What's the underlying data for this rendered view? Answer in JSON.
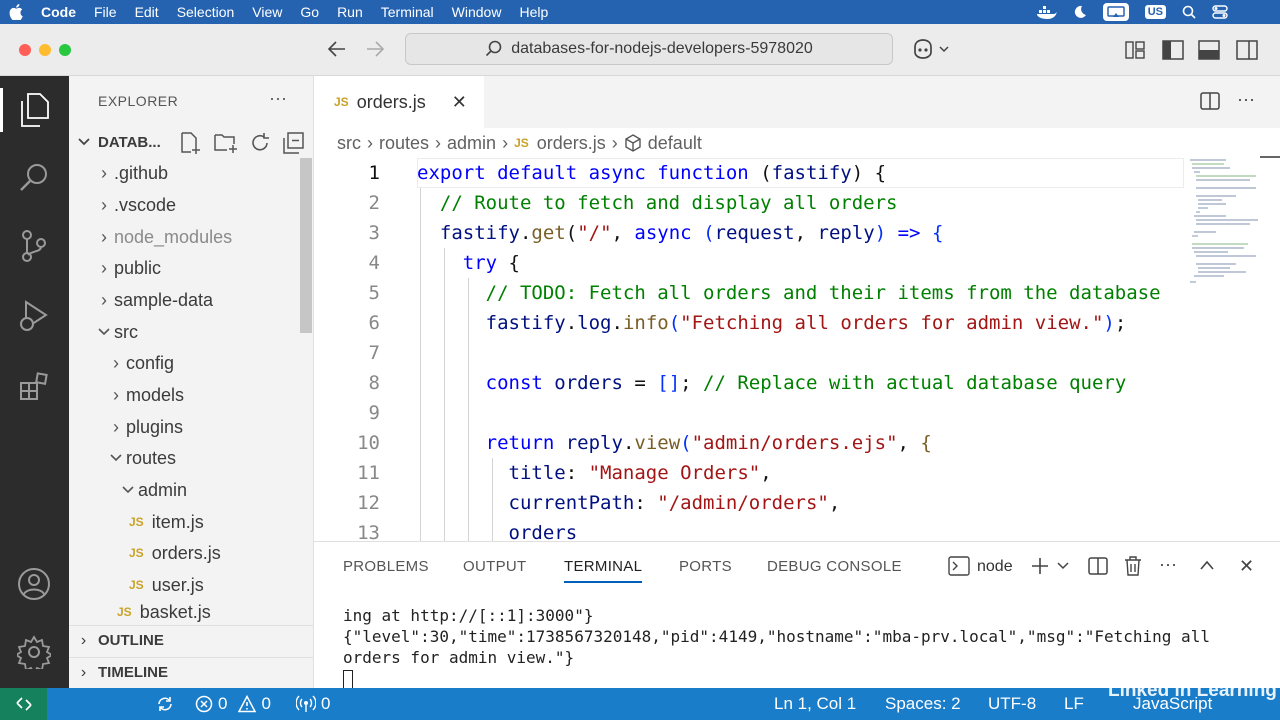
{
  "menubar": {
    "app": "Code",
    "items": [
      "File",
      "Edit",
      "Selection",
      "View",
      "Go",
      "Run",
      "Terminal",
      "Window",
      "Help"
    ],
    "input_badge": "US"
  },
  "titlebar": {
    "search_text": "databases-for-nodejs-developers-5978020"
  },
  "explorer": {
    "title": "EXPLORER",
    "root": "DATAB...",
    "tree": [
      {
        "label": ".github",
        "type": "folder",
        "state": "collapsed"
      },
      {
        "label": ".vscode",
        "type": "folder",
        "state": "collapsed"
      },
      {
        "label": "node_modules",
        "type": "folder",
        "state": "collapsed"
      },
      {
        "label": "public",
        "type": "folder",
        "state": "collapsed"
      },
      {
        "label": "sample-data",
        "type": "folder",
        "state": "collapsed"
      },
      {
        "label": "src",
        "type": "folder",
        "state": "expanded"
      },
      {
        "label": "config",
        "type": "folder",
        "state": "collapsed"
      },
      {
        "label": "models",
        "type": "folder",
        "state": "collapsed"
      },
      {
        "label": "plugins",
        "type": "folder",
        "state": "collapsed"
      },
      {
        "label": "routes",
        "type": "folder",
        "state": "expanded"
      },
      {
        "label": "admin",
        "type": "folder",
        "state": "expanded"
      },
      {
        "label": "item.js",
        "type": "file"
      },
      {
        "label": "orders.js",
        "type": "file"
      },
      {
        "label": "user.js",
        "type": "file"
      },
      {
        "label": "basket.js",
        "type": "file"
      }
    ],
    "outline": "OUTLINE",
    "timeline": "TIMELINE",
    "js_badge": "JS"
  },
  "editor": {
    "tab": "orders.js",
    "breadcrumb": [
      "src",
      "routes",
      "admin",
      "orders.js",
      "default"
    ],
    "line_numbers": [
      "1",
      "2",
      "3",
      "4",
      "5",
      "6",
      "7",
      "8",
      "9",
      "10",
      "11",
      "12",
      "13"
    ]
  },
  "panel": {
    "tabs": [
      "PROBLEMS",
      "OUTPUT",
      "TERMINAL",
      "PORTS",
      "DEBUG CONSOLE"
    ],
    "active_tab": "TERMINAL",
    "terminal_name": "node",
    "terminal_lines": [
      "ing at http://[::1]:3000\"}",
      "{\"level\":30,\"time\":1738567320148,\"pid\":4149,\"hostname\":\"mba-prv.local\",\"msg\":\"Fetching all",
      "orders for admin view.\"}"
    ]
  },
  "statusbar": {
    "errors": "0",
    "warnings": "0",
    "ports": "0",
    "position": "Ln 1, Col 1",
    "spaces": "Spaces: 2",
    "encoding": "UTF-8",
    "eol": "LF",
    "language": "JavaScript"
  },
  "watermark": "Linked in Learning",
  "colors": {
    "menubar": "#2563b0",
    "statusbar": "#1a7dc9",
    "remote": "#16825d",
    "keyword": "#0000ff",
    "string": "#a31515",
    "comment": "#008000",
    "function": "#795e26"
  }
}
